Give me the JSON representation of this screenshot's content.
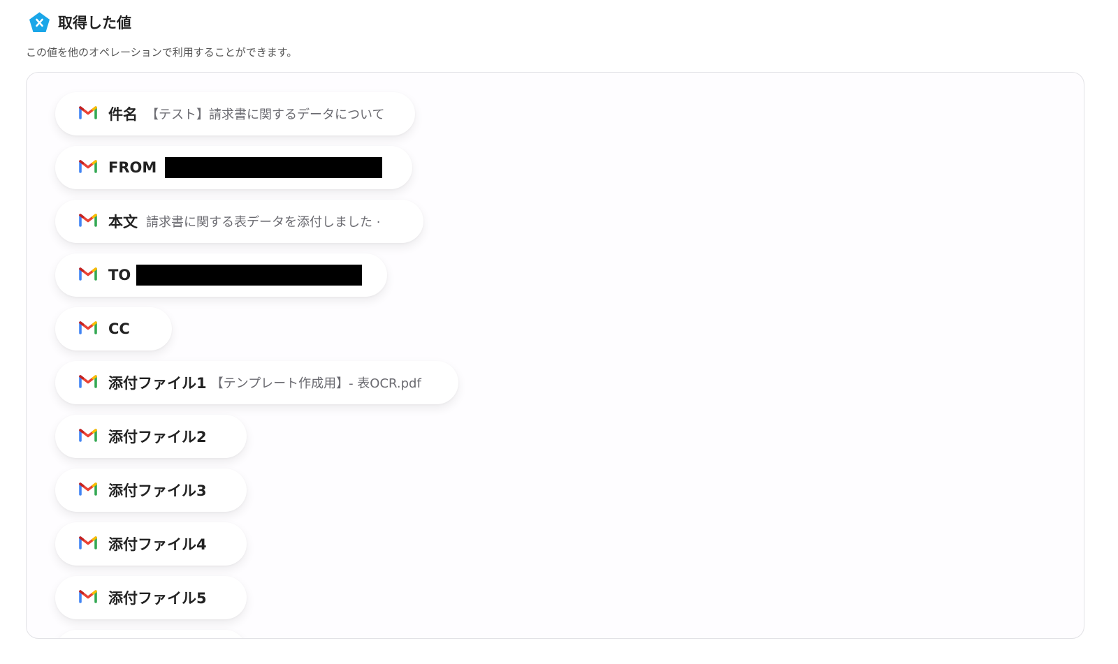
{
  "header": {
    "title": "取得した値",
    "subtitle": "この値を他のオペレーションで利用することができます。"
  },
  "items": [
    {
      "label": "件名",
      "value": "【テスト】請求書に関するデータについて"
    },
    {
      "label": "FROM",
      "value": ""
    },
    {
      "label": "本文",
      "value": "請求書に関する表データを添付しました ·"
    },
    {
      "label": "TO",
      "value": ""
    },
    {
      "label": "CC",
      "value": ""
    },
    {
      "label": "添付ファイル1",
      "value": "【テンプレート作成用】- 表OCR.pdf"
    },
    {
      "label": "添付ファイル2",
      "value": ""
    },
    {
      "label": "添付ファイル3",
      "value": ""
    },
    {
      "label": "添付ファイル4",
      "value": ""
    },
    {
      "label": "添付ファイル5",
      "value": ""
    }
  ],
  "icons": {
    "brand": "yoom-logo-icon",
    "item": "gmail-icon"
  },
  "colors": {
    "brand": "#1aa6e8",
    "gmail_red": "#ea4335",
    "gmail_blue": "#4285f4",
    "gmail_green": "#34a853",
    "gmail_yellow": "#fbbc04"
  }
}
